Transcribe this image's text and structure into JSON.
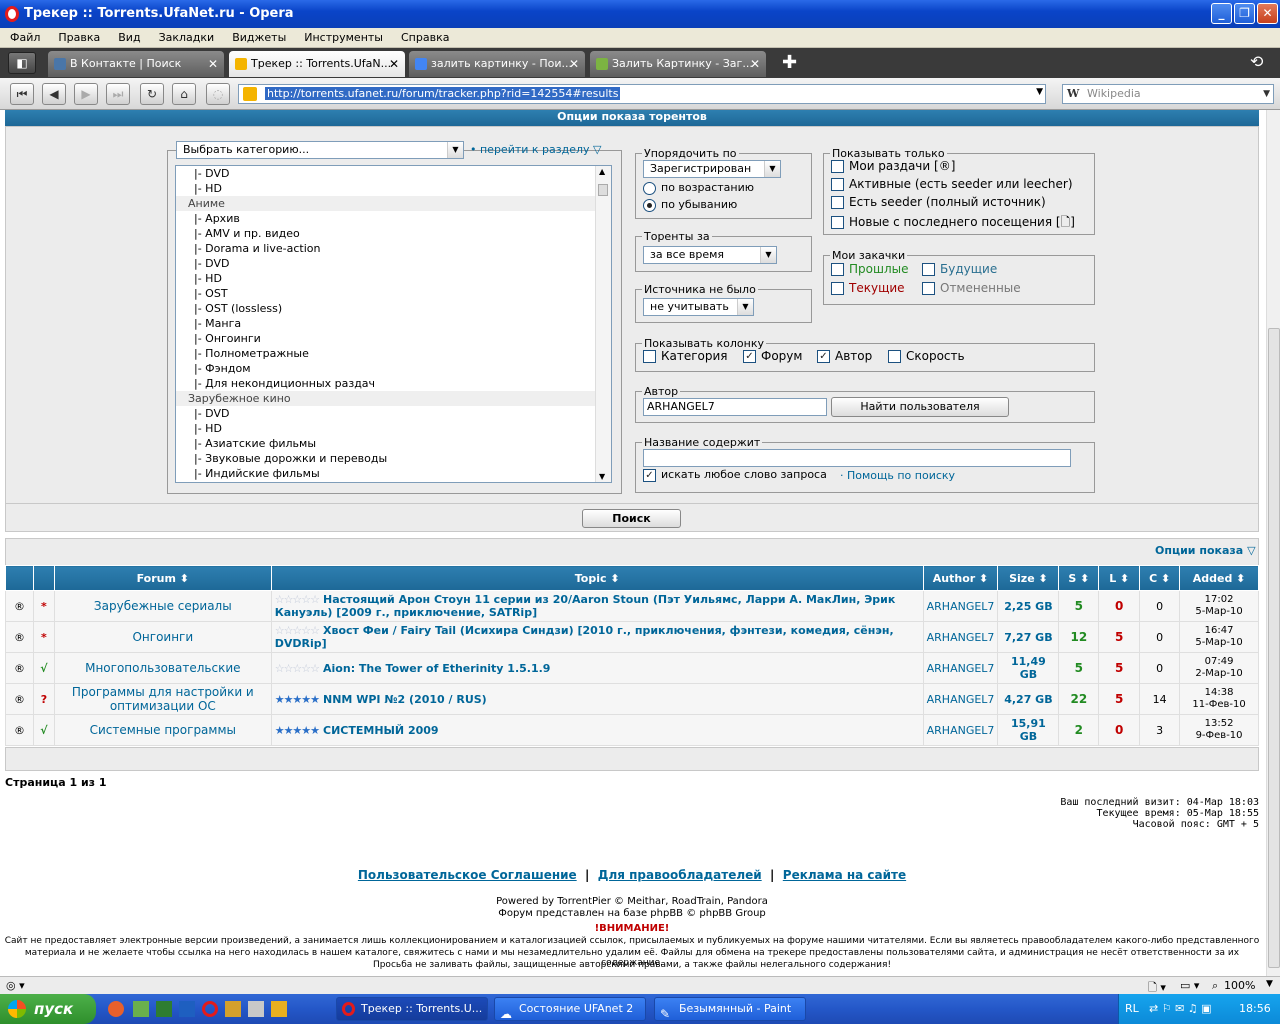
{
  "window": {
    "title": "Трекер :: Torrents.UfaNet.ru - Opera"
  },
  "menu": [
    "Файл",
    "Правка",
    "Вид",
    "Закладки",
    "Виджеты",
    "Инструменты",
    "Справка"
  ],
  "tabs": [
    {
      "label": "В Контакте | Поиск"
    },
    {
      "label": "Трекер :: Torrents.UfaN..."
    },
    {
      "label": "залить картинку - Пои..."
    },
    {
      "label": "Залить Картинку - Заг..."
    }
  ],
  "nav": {
    "url": "http://torrents.ufanet.ru/forum/tracker.php?rid=142554#results",
    "search_placeholder": "Wikipedia"
  },
  "options": {
    "header": "Опции показа торентов",
    "category_select": "Выбрать категорию...",
    "goto_link": "• перейти к разделу",
    "categories": [
      {
        "t": "|- DVD",
        "g": false
      },
      {
        "t": "|- HD",
        "g": false
      },
      {
        "t": "Аниме",
        "g": true
      },
      {
        "t": "|- Архив",
        "g": false
      },
      {
        "t": "|- AMV и пр. видео",
        "g": false
      },
      {
        "t": "|- Dorama и live-action",
        "g": false
      },
      {
        "t": "|- DVD",
        "g": false
      },
      {
        "t": "|- HD",
        "g": false
      },
      {
        "t": "|- OST",
        "g": false
      },
      {
        "t": "|- OST (lossless)",
        "g": false
      },
      {
        "t": "|- Манга",
        "g": false
      },
      {
        "t": "|- Онгоинги",
        "g": false
      },
      {
        "t": "|- Полнометражные",
        "g": false
      },
      {
        "t": "|- Фэндом",
        "g": false
      },
      {
        "t": "|- Для некондиционных раздач",
        "g": false
      },
      {
        "t": "Зарубежное кино",
        "g": true
      },
      {
        "t": "|- DVD",
        "g": false
      },
      {
        "t": "|- HD",
        "g": false
      },
      {
        "t": "|- Азиатские фильмы",
        "g": false
      },
      {
        "t": "|- Звуковые дорожки и переводы",
        "g": false
      },
      {
        "t": "|- Индийские фильмы",
        "g": false
      }
    ],
    "sort": {
      "legend": "Упорядочить по",
      "value": "Зарегистрирован",
      "asc": "по возрастанию",
      "desc": "по убыванию"
    },
    "period": {
      "legend": "Торенты за",
      "value": "за все время"
    },
    "nosource": {
      "legend": "Источника не было",
      "value": "не учитывать"
    },
    "showonly": {
      "legend": "Показывать только",
      "items": [
        "Мои раздачи [®]",
        "Активные (есть seeder или leecher)",
        "Есть seeder (полный источник)",
        "Новые с последнего посещения [🗋]"
      ]
    },
    "mydl": {
      "legend": "Мои закачки",
      "past": "Прошлые",
      "future": "Будущие",
      "current": "Текущие",
      "cancelled": "Отмененные"
    },
    "columns": {
      "legend": "Показывать колонку",
      "items": [
        "Категория",
        "Форум",
        "Автор",
        "Скорость"
      ]
    },
    "author": {
      "legend": "Автор",
      "value": "ARHANGEL7",
      "button": "Найти пользователя"
    },
    "title": {
      "legend": "Название содержит",
      "anyword": "искать любое слово запроса",
      "help_sep": "·",
      "help": "Помощь по поиску"
    },
    "search_button": "Поиск"
  },
  "results": {
    "options_link": "Опции показа",
    "headers": [
      "Forum",
      "Topic",
      "Author",
      "Size",
      "S",
      "L",
      "C",
      "Added"
    ],
    "rows": [
      {
        "status": "*",
        "status_color": "#c00000",
        "forum": "Зарубежные сериалы",
        "stars": 0,
        "topic": "Настоящий Арон Стоун 11 серии из 20/Aaron Stoun (Пэт Уильямс, Ларри А. МакЛин, Эрик Кануэль) [2009 г., приключение, SATRip]",
        "author": "ARHANGEL7",
        "size": "2,25 GB",
        "s": "5",
        "l": "0",
        "c": "0",
        "time": "17:02",
        "date": "5-Мар-10"
      },
      {
        "status": "*",
        "status_color": "#c00000",
        "forum": "Онгоинги",
        "stars": 0,
        "topic": "Хвост Феи / Fairy Tail (Исихира Синдзи) [2010 г., приключения, фэнтези, комедия, сёнэн, DVDRip]",
        "author": "ARHANGEL7",
        "size": "7,27 GB",
        "s": "12",
        "l": "5",
        "c": "0",
        "time": "16:47",
        "date": "5-Мар-10"
      },
      {
        "status": "√",
        "status_color": "#228b22",
        "forum": "Многопользовательские",
        "stars": 0,
        "topic": "Aion: The Tower of Etherinity 1.5.1.9",
        "author": "ARHANGEL7",
        "size": "11,49 GB",
        "s": "5",
        "l": "5",
        "c": "0",
        "time": "07:49",
        "date": "2-Мар-10"
      },
      {
        "status": "?",
        "status_color": "#c00000",
        "forum": "Программы для настройки и оптимизации ОС",
        "stars": 5,
        "topic": "NNM WPI №2 (2010 / RUS)",
        "author": "ARHANGEL7",
        "size": "4,27 GB",
        "s": "22",
        "l": "5",
        "c": "14",
        "time": "14:38",
        "date": "11-Фев-10"
      },
      {
        "status": "√",
        "status_color": "#228b22",
        "forum": "Системные программы",
        "stars": 5,
        "topic": "СИСТЕМНЫЙ 2009",
        "author": "ARHANGEL7",
        "size": "15,91 GB",
        "s": "2",
        "l": "0",
        "c": "3",
        "time": "13:52",
        "date": "9-Фев-10"
      }
    ],
    "page": "Страница 1 из 1",
    "last_visit": "Ваш последний визит: 04-Мар 18:03",
    "current_time": "Текущее время: 05-Мар 18:55",
    "tz": "Часовой пояс: GMT + 5"
  },
  "footer": {
    "links": [
      "Пользовательское Соглашение",
      "Для правообладателей",
      "Реклама на сайте"
    ],
    "sep": "|",
    "powered": "Powered by TorrentPier © Meithar, RoadTrain, Pandora",
    "forum_base": "Форум представлен на базе phpBB © phpBB Group",
    "warning": "!ВНИМАНИЕ!",
    "disclaimer1": "Сайт не предоставляет электронные версии произведений, а занимается лишь коллекционированием и каталогизацией ссылок, присылаемых и публикуемых на форуме нашими читателями. Если вы являетесь правообладателем какого-либо представленного",
    "disclaimer2": "материала и не желаете чтобы ссылка на него находилась в нашем каталоге, свяжитесь с нами и мы незамедлительно удалим её. Файлы для обмена на трекере предоставлены пользователями сайта, и администрация не несёт ответственности за их содержание.",
    "disclaimer3": "Просьба не заливать файлы, защищенные авторскими правами, а также файлы нелегального содержания!"
  },
  "status": {
    "zoom": "100%"
  },
  "taskbar": {
    "start": "пуск",
    "items": [
      "Трекер :: Torrents.U...",
      "Состояние UFAnet 2",
      "Безымянный - Paint"
    ],
    "lang": "RL",
    "clock": "18:56"
  }
}
